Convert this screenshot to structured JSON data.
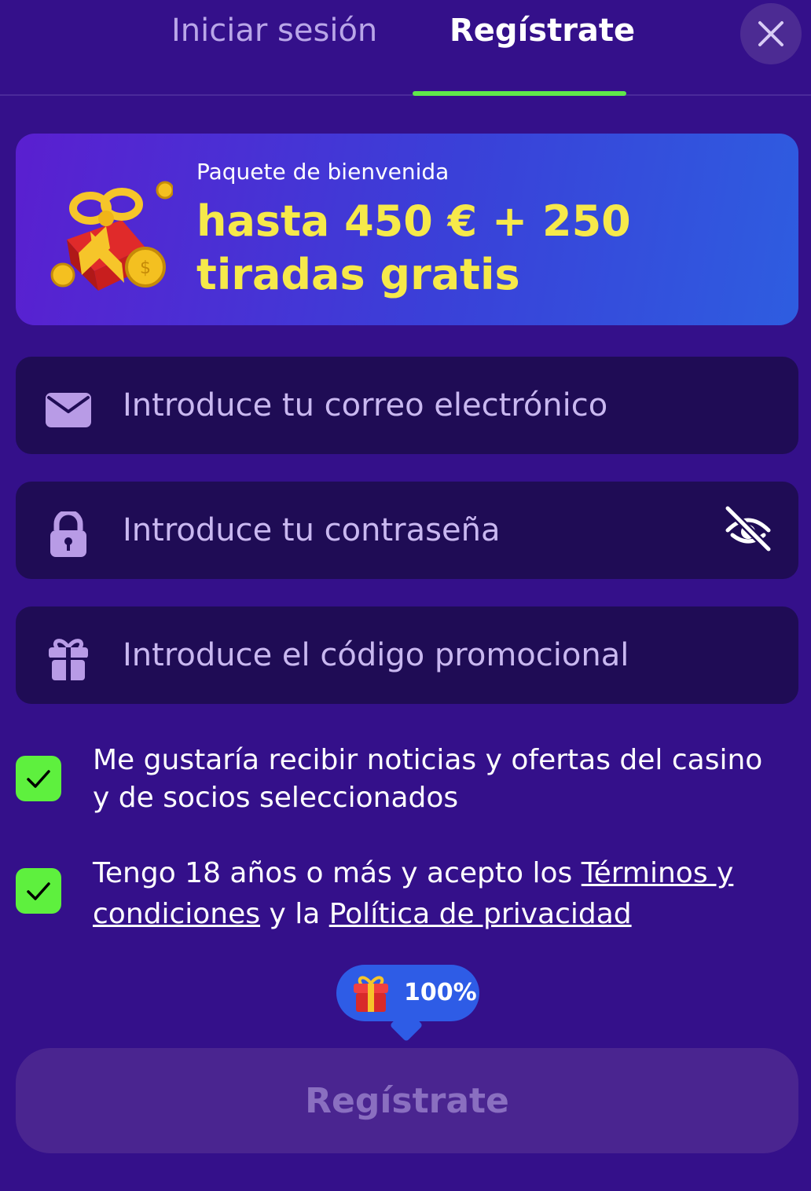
{
  "tabs": {
    "login_label": "Iniciar sesión",
    "register_label": "Regístrate",
    "active": "register"
  },
  "close_icon": "close-icon",
  "banner": {
    "subtitle": "Paquete de bienvenida",
    "title": "hasta 450 € + 250 tiradas gratis",
    "icon": "gift-coins-icon"
  },
  "form": {
    "email": {
      "placeholder": "Introduce tu correo electrónico",
      "value": "",
      "icon": "envelope-icon"
    },
    "password": {
      "placeholder": "Introduce tu contraseña",
      "value": "",
      "icon": "lock-icon",
      "toggle_icon": "eye-off-icon"
    },
    "promo": {
      "placeholder": "Introduce el código promocional",
      "value": "",
      "icon": "gift-icon"
    }
  },
  "consents": {
    "news": {
      "checked": true,
      "text": "Me gustaría recibir noticias y ofertas del casino y de socios seleccionados"
    },
    "terms": {
      "checked": true,
      "text_before": "Tengo 18 años o más y acepto los ",
      "terms_link": "Términos y condiciones",
      "text_middle": " y la ",
      "privacy_link": "Política de privacidad"
    }
  },
  "progress": {
    "label": "100%",
    "value": 1.0,
    "icon": "gift-icon"
  },
  "submit": {
    "label": "Regístrate",
    "enabled": false
  },
  "colors": {
    "background": "#34108a",
    "accent_green": "#5fe84a",
    "banner_title": "#f6e94a",
    "field_bg": "#1f0c55",
    "bubble": "#2e5ce6"
  }
}
